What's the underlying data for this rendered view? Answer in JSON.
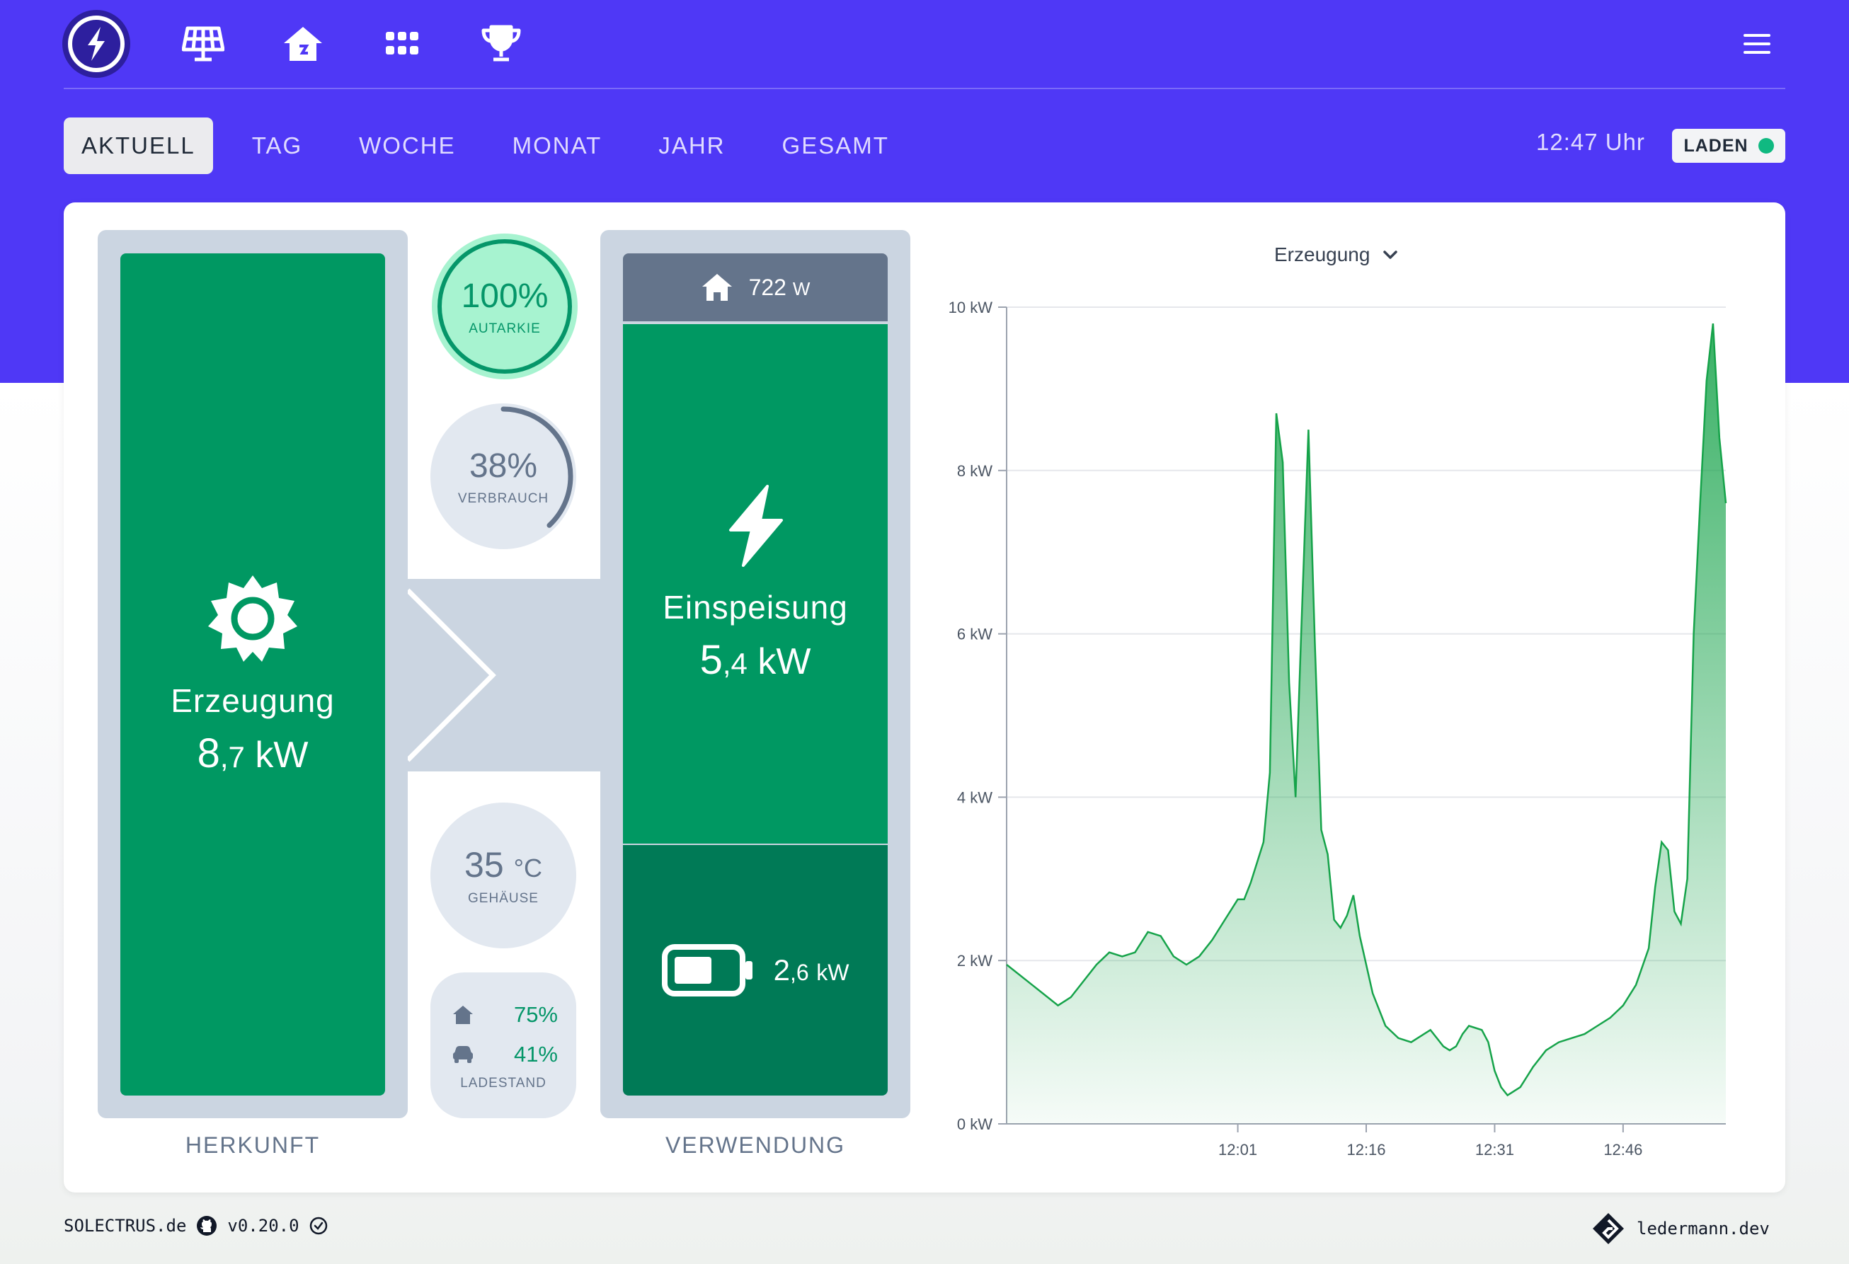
{
  "nav": {
    "icons": [
      "solar-panel-icon",
      "house-icon",
      "grid-icon",
      "trophy-icon"
    ],
    "menu_icon": "hamburger-icon"
  },
  "tabs": [
    {
      "label": "AKTUELL",
      "active": true
    },
    {
      "label": "TAG",
      "active": false
    },
    {
      "label": "WOCHE",
      "active": false
    },
    {
      "label": "MONAT",
      "active": false
    },
    {
      "label": "JAHR",
      "active": false
    },
    {
      "label": "GESAMT",
      "active": false
    }
  ],
  "status": {
    "time": "12:47 Uhr",
    "badge": "LADEN",
    "badge_color": "#10b981"
  },
  "herkunft": {
    "label": "HERKUNFT",
    "generation": {
      "title": "Erzeugung",
      "value_int": "8",
      "value_dec": ",7",
      "unit": "kW"
    }
  },
  "verwendung": {
    "label": "VERWENDUNG",
    "house": {
      "value": "722",
      "unit": "W"
    },
    "feed_in": {
      "title": "Einspeisung",
      "value_int": "5",
      "value_dec": ",4",
      "unit": "kW"
    },
    "battery": {
      "value_int": "2",
      "value_dec": ",6",
      "unit": "kW"
    }
  },
  "autarkie": {
    "value": "100%",
    "label": "AUTARKIE"
  },
  "verbrauch": {
    "value": "38%",
    "label": "VERBRAUCH",
    "fraction": 0.38
  },
  "gehaeuse": {
    "value": "35",
    "unit": "°C",
    "label": "GEHÄUSE"
  },
  "ladestand": {
    "house": "75%",
    "car": "41%",
    "label": "LADESTAND"
  },
  "chart_select": {
    "label": "Erzeugung"
  },
  "chart_data": {
    "type": "area",
    "series": [
      {
        "color": "#16a34a",
        "points": [
          [
            0,
            1.95
          ],
          [
            4,
            1.7
          ],
          [
            8,
            1.45
          ],
          [
            10,
            1.55
          ],
          [
            14,
            1.95
          ],
          [
            16,
            2.1
          ],
          [
            18,
            2.05
          ],
          [
            20,
            2.1
          ],
          [
            22,
            2.35
          ],
          [
            24,
            2.3
          ],
          [
            26,
            2.05
          ],
          [
            28,
            1.95
          ],
          [
            30,
            2.05
          ],
          [
            32,
            2.25
          ],
          [
            34,
            2.5
          ],
          [
            36,
            2.75
          ],
          [
            37,
            2.75
          ],
          [
            38,
            2.95
          ],
          [
            39,
            3.2
          ],
          [
            40,
            3.45
          ],
          [
            41,
            4.3
          ],
          [
            42,
            8.7
          ],
          [
            43,
            8.1
          ],
          [
            44,
            5.4
          ],
          [
            45,
            4.0
          ],
          [
            46,
            6.3
          ],
          [
            47,
            8.5
          ],
          [
            48,
            5.9
          ],
          [
            49,
            3.6
          ],
          [
            50,
            3.3
          ],
          [
            51,
            2.5
          ],
          [
            52,
            2.4
          ],
          [
            53,
            2.55
          ],
          [
            54,
            2.8
          ],
          [
            55,
            2.3
          ],
          [
            57,
            1.6
          ],
          [
            59,
            1.2
          ],
          [
            61,
            1.05
          ],
          [
            63,
            1.0
          ],
          [
            65,
            1.1
          ],
          [
            66,
            1.15
          ],
          [
            68,
            0.95
          ],
          [
            69,
            0.9
          ],
          [
            70,
            0.95
          ],
          [
            71,
            1.1
          ],
          [
            72,
            1.2
          ],
          [
            74,
            1.15
          ],
          [
            75,
            1.0
          ],
          [
            76,
            0.65
          ],
          [
            77,
            0.45
          ],
          [
            78,
            0.35
          ],
          [
            80,
            0.45
          ],
          [
            82,
            0.7
          ],
          [
            84,
            0.9
          ],
          [
            86,
            1.0
          ],
          [
            88,
            1.05
          ],
          [
            90,
            1.1
          ],
          [
            92,
            1.2
          ],
          [
            94,
            1.3
          ],
          [
            96,
            1.45
          ],
          [
            98,
            1.7
          ],
          [
            100,
            2.15
          ],
          [
            101,
            2.9
          ],
          [
            102,
            3.45
          ],
          [
            103,
            3.35
          ],
          [
            104,
            2.6
          ],
          [
            105,
            2.45
          ],
          [
            106,
            3.0
          ],
          [
            107,
            6.0
          ],
          [
            108,
            7.6
          ],
          [
            109,
            9.1
          ],
          [
            110,
            9.8
          ],
          [
            111,
            8.4
          ],
          [
            112,
            7.6
          ]
        ]
      }
    ],
    "x_labels": [
      {
        "t": 36,
        "label": "12:01"
      },
      {
        "t": 56,
        "label": "12:16"
      },
      {
        "t": 76,
        "label": "12:31"
      },
      {
        "t": 96,
        "label": "12:46"
      }
    ],
    "y_ticks": [
      0,
      2,
      4,
      6,
      8,
      10
    ],
    "y_tick_labels": [
      "0 kW",
      "2 kW",
      "4 kW",
      "6 kW",
      "8 kW",
      "10 kW"
    ],
    "x_domain": [
      0,
      112
    ],
    "ylim": [
      0,
      10
    ],
    "grid": true
  },
  "footer": {
    "brand": "SOLECTRUS.de",
    "version": "v0.20.0",
    "credit": "ledermann.dev"
  }
}
